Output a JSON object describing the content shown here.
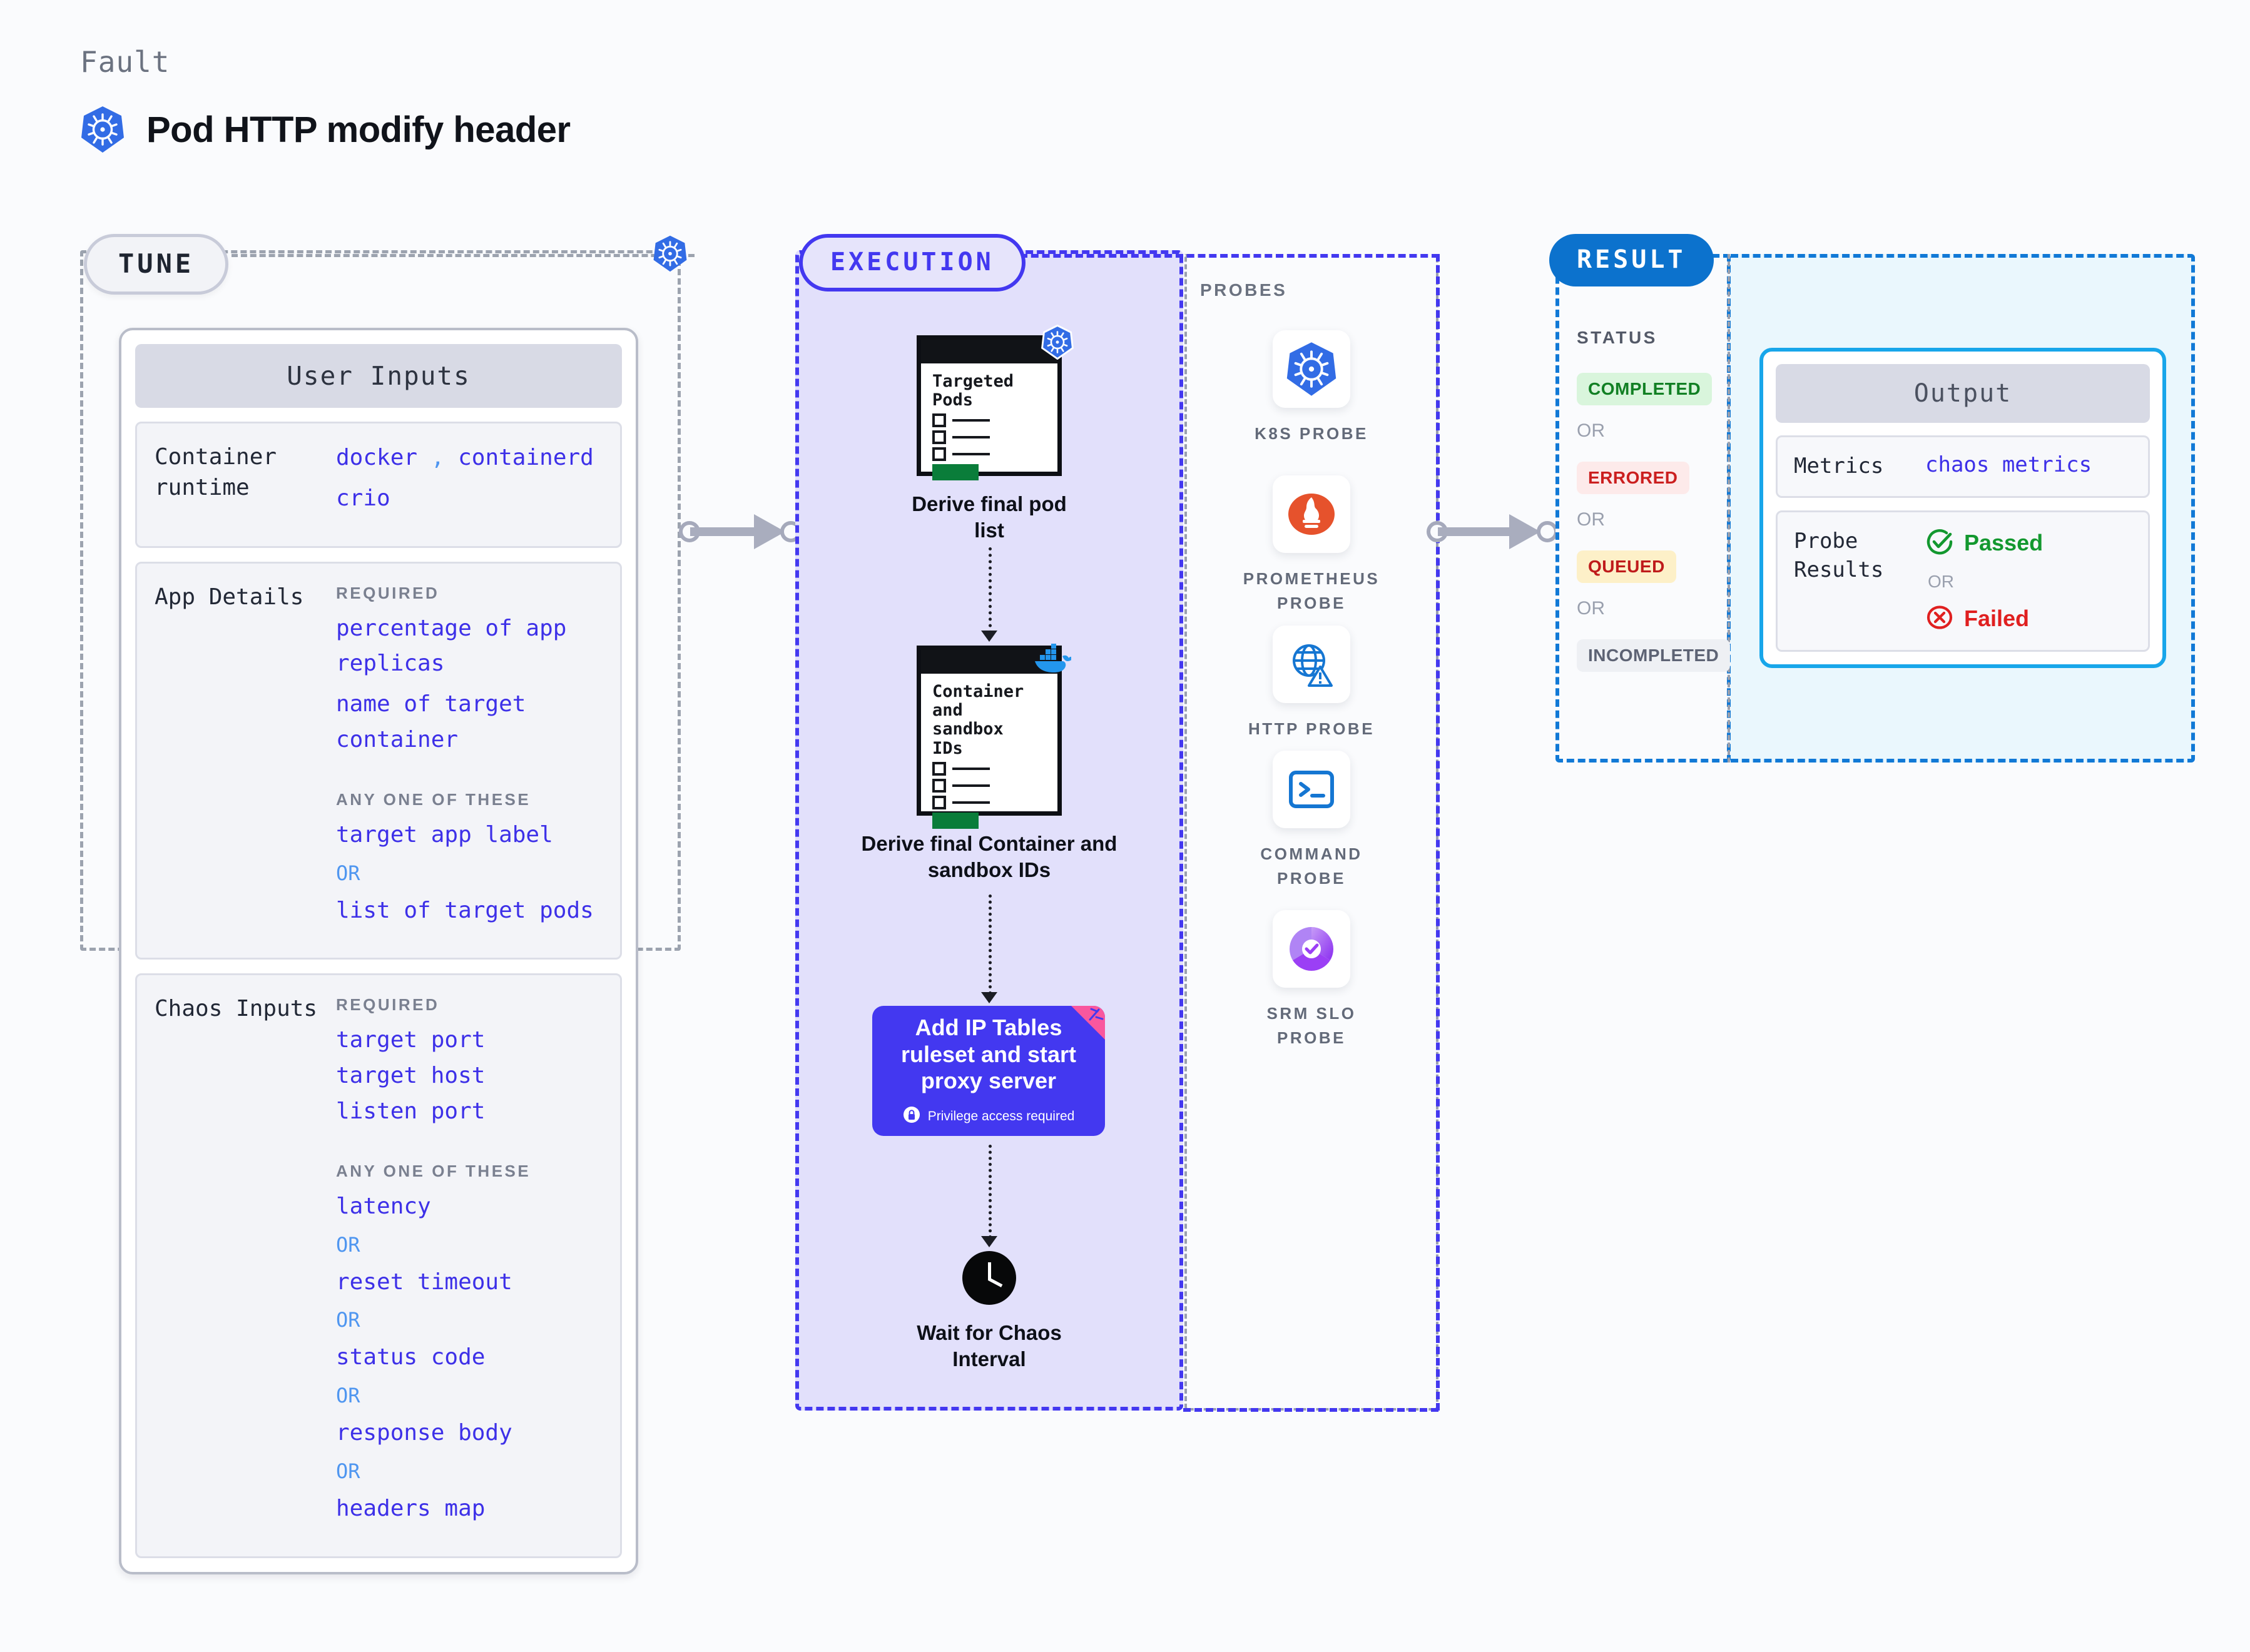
{
  "header": {
    "eyebrow": "Fault",
    "title": "Pod HTTP modify header",
    "icon": "kubernetes-icon"
  },
  "tune": {
    "chip_label": "TUNE",
    "edge_icon": "kubernetes-icon",
    "card_title": "User Inputs",
    "sections": [
      {
        "label": "Container\nruntime",
        "groups": [
          {
            "title": "",
            "items": [
              "docker , containerd",
              "crio"
            ]
          }
        ]
      },
      {
        "label": "App Details",
        "groups": [
          {
            "title": "REQUIRED",
            "items": [
              "percentage of app replicas",
              "name of target container"
            ]
          },
          {
            "title": "ANY ONE OF THESE",
            "items": [
              "target app label",
              "OR",
              "list of target pods"
            ]
          }
        ]
      },
      {
        "label": "Chaos Inputs",
        "groups": [
          {
            "title": "REQUIRED",
            "items": [
              "target port",
              "target host",
              "listen port"
            ]
          },
          {
            "title": "ANY ONE OF THESE",
            "items": [
              "latency",
              "OR",
              "reset timeout",
              "OR",
              "status code",
              "OR",
              "response body",
              "OR",
              "headers map"
            ]
          }
        ]
      }
    ],
    "runtime_label_line1": "Container",
    "runtime_label_line2": "runtime",
    "runtime_values": {
      "docker": "docker",
      "comma": ",",
      "containerd": "containerd",
      "crio": "crio"
    },
    "app_details_label": "App Details",
    "chaos_inputs_label": "Chaos Inputs",
    "required_title": "REQUIRED",
    "anyone_title": "ANY ONE OF THESE",
    "or_text": "OR",
    "app_required": [
      "percentage of app",
      "replicas",
      "name of target",
      "container"
    ],
    "app_anyone_first": "target app label",
    "app_anyone_second": "list of target pods",
    "chaos_required": [
      "target port",
      "target host",
      "listen port"
    ],
    "chaos_anyone": [
      "latency",
      "reset timeout",
      "status code",
      "response body",
      "headers map"
    ]
  },
  "execution": {
    "chip_label": "EXECUTION",
    "nodes": [
      {
        "doc_title_lines": [
          "Targeted",
          "Pods"
        ],
        "caption": "Derive final pod list",
        "badge_icon": "kubernetes-icon"
      },
      {
        "doc_title_lines": [
          "Container",
          "and",
          "sandbox",
          "IDs"
        ],
        "caption_line1": "Derive final Container and",
        "caption_line2": "sandbox IDs",
        "badge_icon": "docker-icon"
      }
    ],
    "action": {
      "title_lines": [
        "Add IP Tables",
        "ruleset and start",
        "proxy server"
      ],
      "privilege_text": "Privilege access required",
      "privilege_icon": "lock-icon",
      "color": "#4338f0",
      "ribbon_color": "#f9579e"
    },
    "wait": {
      "caption_line1": "Wait for Chaos",
      "caption_line2": "Interval",
      "icon": "clock-icon"
    }
  },
  "probes": {
    "label": "PROBES",
    "items": [
      {
        "name": "K8S  PROBE",
        "icon": "kubernetes-icon"
      },
      {
        "name": "PROMETHEUS",
        "name2": "PROBE",
        "icon": "prometheus-icon"
      },
      {
        "name": "HTTP  PROBE",
        "icon": "globe-warning-icon"
      },
      {
        "name": "COMMAND",
        "name2": "PROBE",
        "icon": "terminal-icon"
      },
      {
        "name": "SRM  SLO",
        "name2": "PROBE",
        "icon": "slo-donut-icon"
      }
    ]
  },
  "result": {
    "chip_label": "RESULT",
    "status_label": "STATUS",
    "or_text": "OR",
    "badges": [
      {
        "text": "COMPLETED",
        "bg": "#d9f5dc",
        "fg": "#128024"
      },
      {
        "text": "ERRORED",
        "bg": "#fdeaea",
        "fg": "#cb1f1f"
      },
      {
        "text": "QUEUED",
        "bg": "#fdf0c8",
        "fg": "#bf1b1b"
      },
      {
        "text": "INCOMPLETED",
        "bg": "#eef0f4",
        "fg": "#5d6374"
      }
    ],
    "output": {
      "title": "Output",
      "metrics_label": "Metrics",
      "metrics_value": "chaos metrics",
      "probe_results_label_line1": "Probe",
      "probe_results_label_line2": "Results",
      "passed_text": "Passed",
      "failed_text": "Failed",
      "or_text": "OR",
      "passed_icon": "check-circle-icon",
      "failed_icon": "x-circle-icon",
      "passed_color": "#13982f",
      "failed_color": "#e02020"
    }
  },
  "connectors": {
    "tune_to_execution": "arrow-right",
    "probes_to_result": "arrow-right"
  }
}
